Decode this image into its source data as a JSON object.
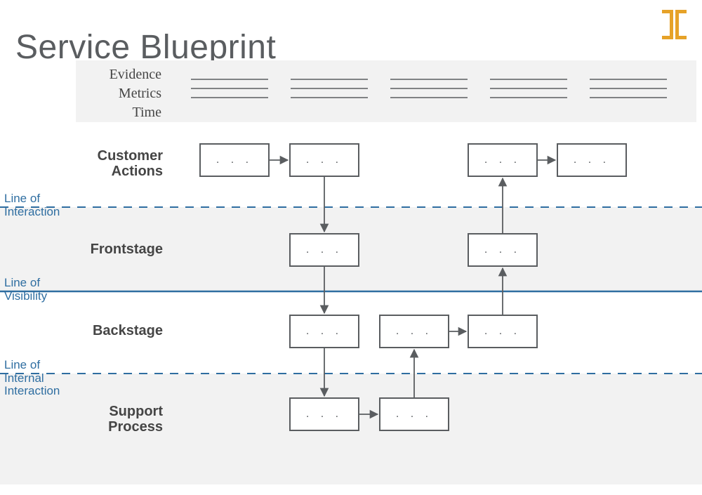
{
  "title": "Service Blueprint",
  "evidenceLabels": {
    "evidence": "Evidence",
    "metrics": "Metrics",
    "time": "Time"
  },
  "rows": {
    "customerActions": "Customer Actions",
    "frontstage": "Frontstage",
    "backstage": "Backstage",
    "supportProcess": "Support Process"
  },
  "separators": {
    "interaction": "Line of Interaction",
    "visibility": "Line of Visibility",
    "internal": "Line of Internal Interaction"
  },
  "placeholder": ". . .",
  "colors": {
    "accent": "#e6a228",
    "gray": "#5a5d60",
    "lightGray": "#f2f2f2",
    "blue": "#2f6ea1"
  }
}
